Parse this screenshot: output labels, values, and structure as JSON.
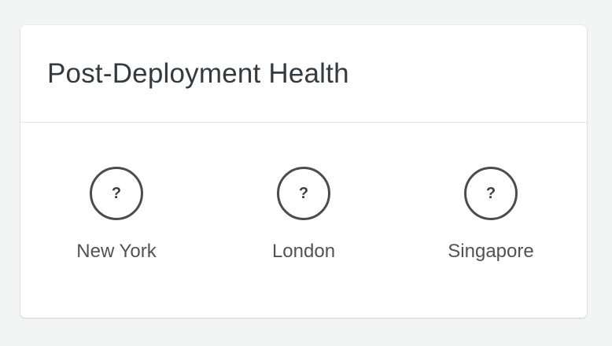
{
  "panel": {
    "title": "Post-Deployment Health"
  },
  "regions": [
    {
      "name": "New York",
      "status_glyph": "?",
      "icon": "question-circle-icon"
    },
    {
      "name": "London",
      "status_glyph": "?",
      "icon": "question-circle-icon"
    },
    {
      "name": "Singapore",
      "status_glyph": "?",
      "icon": "question-circle-icon"
    }
  ],
  "colors": {
    "background": "#f3f4f4",
    "card": "#ffffff",
    "title_text": "#333a40",
    "icon_stroke": "#4a4d50",
    "label_text": "#4f5357"
  }
}
